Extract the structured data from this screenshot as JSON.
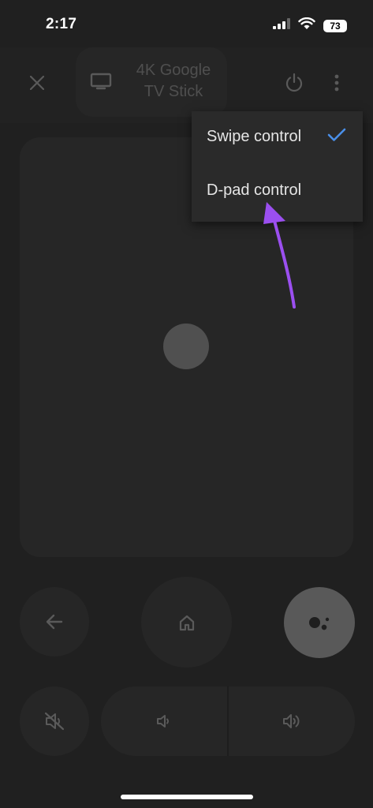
{
  "status_bar": {
    "time": "2:17",
    "battery": "73"
  },
  "header": {
    "device_name": "4K Google TV Stick"
  },
  "menu": {
    "items": [
      {
        "label": "Swipe control",
        "selected": true
      },
      {
        "label": "D-pad control",
        "selected": false
      }
    ]
  },
  "colors": {
    "background": "#202020",
    "surface": "#262626",
    "check": "#4a8fe8",
    "annotation_arrow": "#9b4ff0"
  },
  "icons": {
    "close": "close-icon",
    "tv": "tv-icon",
    "power": "power-icon",
    "more": "more-vert-icon",
    "back": "arrow-back-icon",
    "home": "home-icon",
    "assistant": "google-assistant-icon",
    "mute": "volume-mute-icon",
    "volume_down": "volume-down-icon",
    "volume_up": "volume-up-icon"
  }
}
